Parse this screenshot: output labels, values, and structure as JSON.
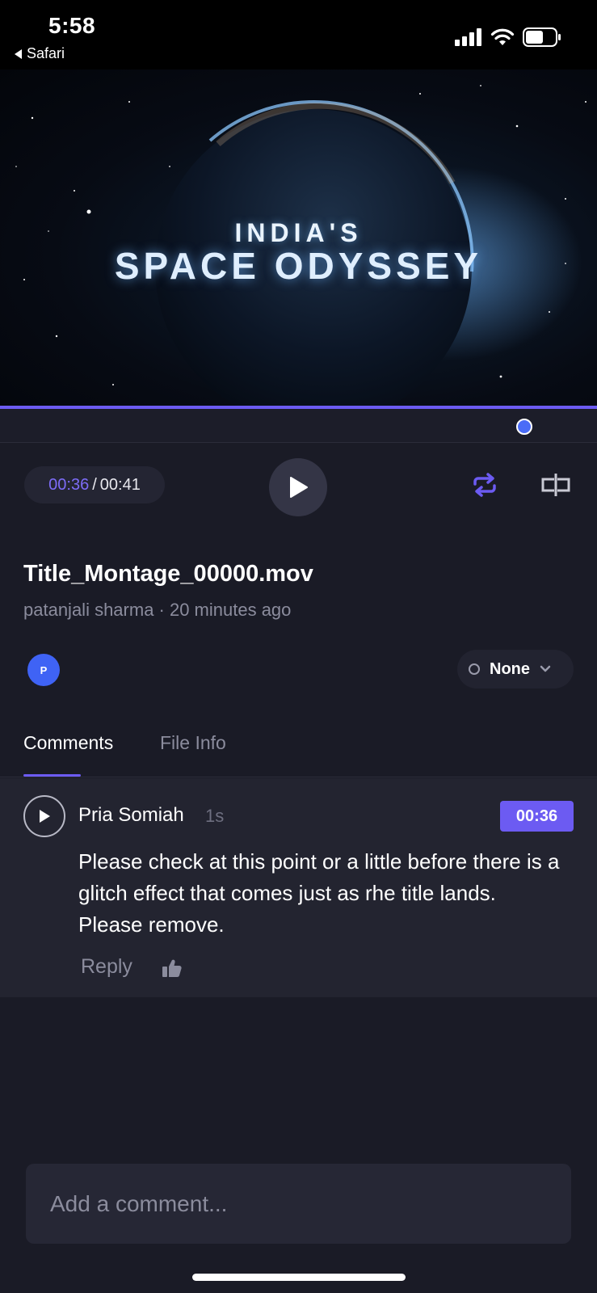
{
  "status_bar": {
    "time": "5:58",
    "back_label": "Safari",
    "icons": [
      "signal-icon",
      "wifi-icon",
      "battery-icon"
    ]
  },
  "video": {
    "title_small": "INDIA'S",
    "title_big": "SPACE ODYSSEY",
    "progress": 1.0,
    "scrub_position": 0.878
  },
  "player": {
    "current_time": "00:36",
    "separator": "/",
    "total_time": "00:41",
    "icons": [
      "play-icon",
      "loop-icon",
      "compare-icon"
    ],
    "accent_color": "#6c5bf2"
  },
  "file": {
    "name": "Title_Montage_00000.mov",
    "meta": "patanjali sharma · 20 minutes ago"
  },
  "reviewer": {
    "avatar_initial": "P",
    "status_label": "None"
  },
  "tabs": [
    {
      "label": "Comments",
      "active": true
    },
    {
      "label": "File Info",
      "active": false
    }
  ],
  "comments": [
    {
      "author": "Pria Somiah",
      "age": "1s",
      "timestamp": "00:36",
      "body": "Please check at this point or a little before there is a glitch effect that comes just as rhe title lands. Please remove.",
      "reply_label": "Reply"
    }
  ],
  "composer": {
    "placeholder": "Add a comment..."
  }
}
